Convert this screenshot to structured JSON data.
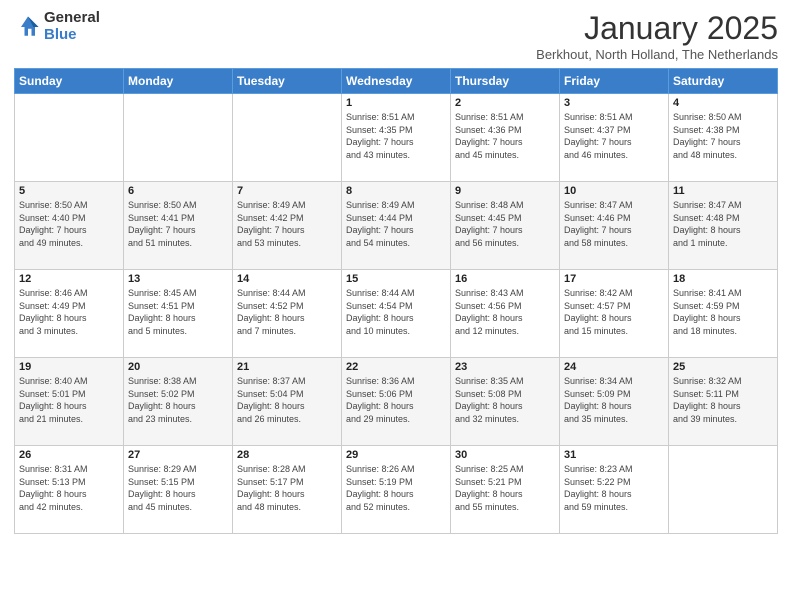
{
  "header": {
    "logo_general": "General",
    "logo_blue": "Blue",
    "month_title": "January 2025",
    "subtitle": "Berkhout, North Holland, The Netherlands"
  },
  "weekdays": [
    "Sunday",
    "Monday",
    "Tuesday",
    "Wednesday",
    "Thursday",
    "Friday",
    "Saturday"
  ],
  "weeks": [
    [
      {
        "day": "",
        "info": ""
      },
      {
        "day": "",
        "info": ""
      },
      {
        "day": "",
        "info": ""
      },
      {
        "day": "1",
        "info": "Sunrise: 8:51 AM\nSunset: 4:35 PM\nDaylight: 7 hours\nand 43 minutes."
      },
      {
        "day": "2",
        "info": "Sunrise: 8:51 AM\nSunset: 4:36 PM\nDaylight: 7 hours\nand 45 minutes."
      },
      {
        "day": "3",
        "info": "Sunrise: 8:51 AM\nSunset: 4:37 PM\nDaylight: 7 hours\nand 46 minutes."
      },
      {
        "day": "4",
        "info": "Sunrise: 8:50 AM\nSunset: 4:38 PM\nDaylight: 7 hours\nand 48 minutes."
      }
    ],
    [
      {
        "day": "5",
        "info": "Sunrise: 8:50 AM\nSunset: 4:40 PM\nDaylight: 7 hours\nand 49 minutes."
      },
      {
        "day": "6",
        "info": "Sunrise: 8:50 AM\nSunset: 4:41 PM\nDaylight: 7 hours\nand 51 minutes."
      },
      {
        "day": "7",
        "info": "Sunrise: 8:49 AM\nSunset: 4:42 PM\nDaylight: 7 hours\nand 53 minutes."
      },
      {
        "day": "8",
        "info": "Sunrise: 8:49 AM\nSunset: 4:44 PM\nDaylight: 7 hours\nand 54 minutes."
      },
      {
        "day": "9",
        "info": "Sunrise: 8:48 AM\nSunset: 4:45 PM\nDaylight: 7 hours\nand 56 minutes."
      },
      {
        "day": "10",
        "info": "Sunrise: 8:47 AM\nSunset: 4:46 PM\nDaylight: 7 hours\nand 58 minutes."
      },
      {
        "day": "11",
        "info": "Sunrise: 8:47 AM\nSunset: 4:48 PM\nDaylight: 8 hours\nand 1 minute."
      }
    ],
    [
      {
        "day": "12",
        "info": "Sunrise: 8:46 AM\nSunset: 4:49 PM\nDaylight: 8 hours\nand 3 minutes."
      },
      {
        "day": "13",
        "info": "Sunrise: 8:45 AM\nSunset: 4:51 PM\nDaylight: 8 hours\nand 5 minutes."
      },
      {
        "day": "14",
        "info": "Sunrise: 8:44 AM\nSunset: 4:52 PM\nDaylight: 8 hours\nand 7 minutes."
      },
      {
        "day": "15",
        "info": "Sunrise: 8:44 AM\nSunset: 4:54 PM\nDaylight: 8 hours\nand 10 minutes."
      },
      {
        "day": "16",
        "info": "Sunrise: 8:43 AM\nSunset: 4:56 PM\nDaylight: 8 hours\nand 12 minutes."
      },
      {
        "day": "17",
        "info": "Sunrise: 8:42 AM\nSunset: 4:57 PM\nDaylight: 8 hours\nand 15 minutes."
      },
      {
        "day": "18",
        "info": "Sunrise: 8:41 AM\nSunset: 4:59 PM\nDaylight: 8 hours\nand 18 minutes."
      }
    ],
    [
      {
        "day": "19",
        "info": "Sunrise: 8:40 AM\nSunset: 5:01 PM\nDaylight: 8 hours\nand 21 minutes."
      },
      {
        "day": "20",
        "info": "Sunrise: 8:38 AM\nSunset: 5:02 PM\nDaylight: 8 hours\nand 23 minutes."
      },
      {
        "day": "21",
        "info": "Sunrise: 8:37 AM\nSunset: 5:04 PM\nDaylight: 8 hours\nand 26 minutes."
      },
      {
        "day": "22",
        "info": "Sunrise: 8:36 AM\nSunset: 5:06 PM\nDaylight: 8 hours\nand 29 minutes."
      },
      {
        "day": "23",
        "info": "Sunrise: 8:35 AM\nSunset: 5:08 PM\nDaylight: 8 hours\nand 32 minutes."
      },
      {
        "day": "24",
        "info": "Sunrise: 8:34 AM\nSunset: 5:09 PM\nDaylight: 8 hours\nand 35 minutes."
      },
      {
        "day": "25",
        "info": "Sunrise: 8:32 AM\nSunset: 5:11 PM\nDaylight: 8 hours\nand 39 minutes."
      }
    ],
    [
      {
        "day": "26",
        "info": "Sunrise: 8:31 AM\nSunset: 5:13 PM\nDaylight: 8 hours\nand 42 minutes."
      },
      {
        "day": "27",
        "info": "Sunrise: 8:29 AM\nSunset: 5:15 PM\nDaylight: 8 hours\nand 45 minutes."
      },
      {
        "day": "28",
        "info": "Sunrise: 8:28 AM\nSunset: 5:17 PM\nDaylight: 8 hours\nand 48 minutes."
      },
      {
        "day": "29",
        "info": "Sunrise: 8:26 AM\nSunset: 5:19 PM\nDaylight: 8 hours\nand 52 minutes."
      },
      {
        "day": "30",
        "info": "Sunrise: 8:25 AM\nSunset: 5:21 PM\nDaylight: 8 hours\nand 55 minutes."
      },
      {
        "day": "31",
        "info": "Sunrise: 8:23 AM\nSunset: 5:22 PM\nDaylight: 8 hours\nand 59 minutes."
      },
      {
        "day": "",
        "info": ""
      }
    ]
  ]
}
